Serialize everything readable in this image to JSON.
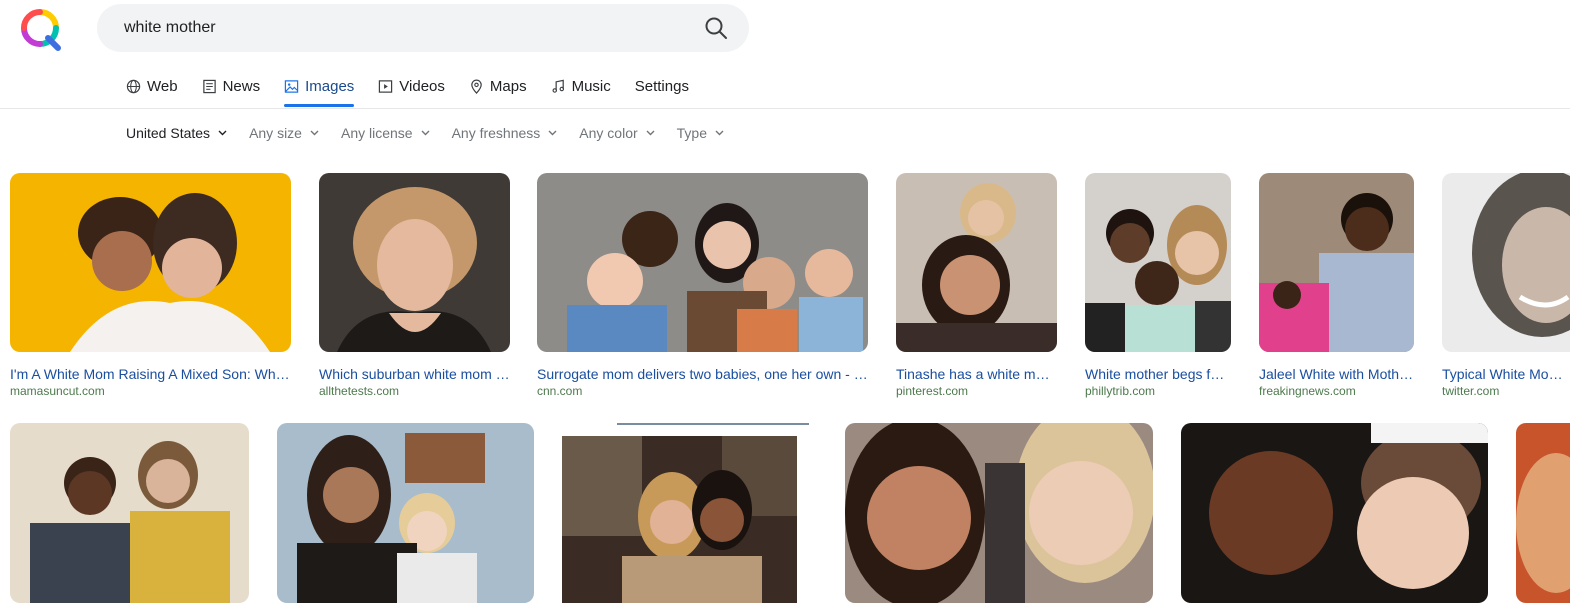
{
  "search": {
    "query": "white mother"
  },
  "tabs": [
    {
      "label": "Web",
      "icon": "globe-icon"
    },
    {
      "label": "News",
      "icon": "news-icon"
    },
    {
      "label": "Images",
      "icon": "image-icon",
      "active": true
    },
    {
      "label": "Videos",
      "icon": "play-icon"
    },
    {
      "label": "Maps",
      "icon": "map-pin-icon"
    },
    {
      "label": "Music",
      "icon": "music-note-icon"
    },
    {
      "label": "Settings"
    }
  ],
  "filters": [
    "United States",
    "Any size",
    "Any license",
    "Any freshness",
    "Any color",
    "Type"
  ],
  "results_row1": [
    {
      "caption": "I'm A White Mom Raising A Mixed Son: What Not to Say",
      "source": "mamasuncut.com"
    },
    {
      "caption": "Which suburban white mom are you?",
      "source": "allthetests.com"
    },
    {
      "caption": "Surrogate mom delivers two babies, one her own - CNN",
      "source": "cnn.com"
    },
    {
      "caption": "Tinashe has a white mother",
      "source": "pinterest.com"
    },
    {
      "caption": "White mother begs for help",
      "source": "phillytrib.com"
    },
    {
      "caption": "Jaleel White with Mother and son",
      "source": "freakingnews.com"
    },
    {
      "caption": "Typical White Mom (@TypicalWhiteMom)",
      "source": "twitter.com"
    }
  ],
  "results_row2_count": 7,
  "colors": {
    "accent": "#1a73e8",
    "caption": "#1a4fa0",
    "source": "#4d7a4d"
  }
}
